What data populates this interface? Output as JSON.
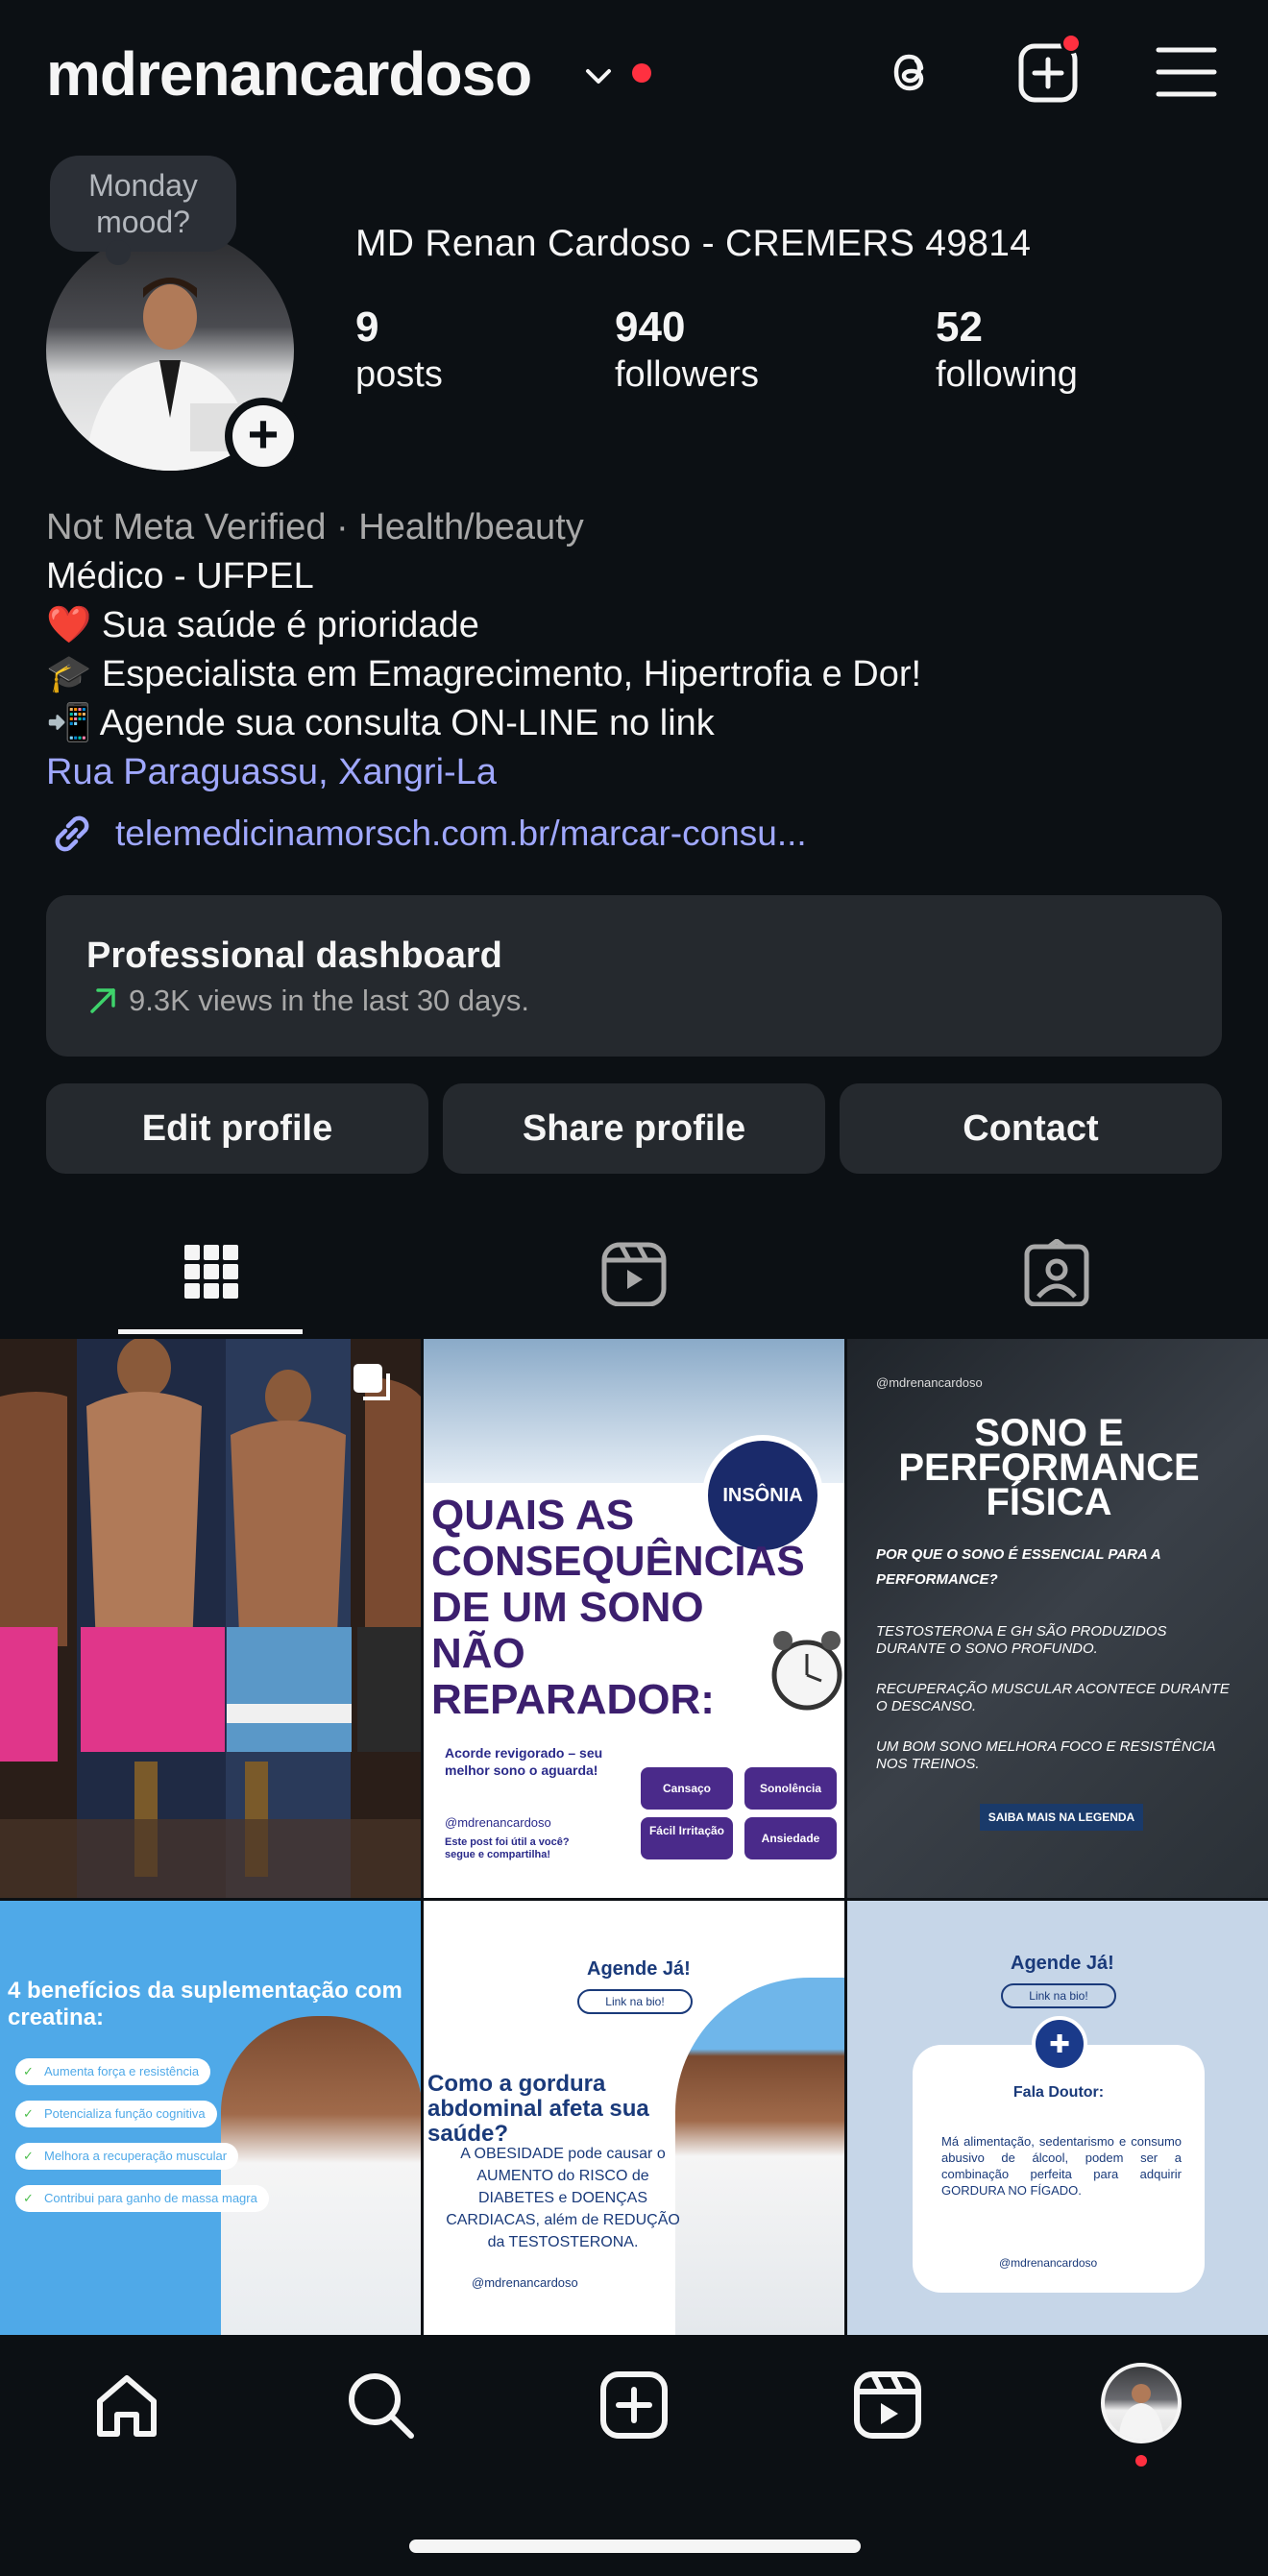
{
  "header": {
    "username": "mdrenancardoso",
    "icons": [
      "chevron-down-icon",
      "threads-icon",
      "create-post-icon",
      "menu-icon"
    ]
  },
  "profile": {
    "note": "Monday mood?",
    "full_name": "MD Renan Cardoso - CREMERS 49814",
    "stats": {
      "posts_count": "9",
      "posts_label": "posts",
      "followers_count": "940",
      "followers_label": "followers",
      "following_count": "52",
      "following_label": "following"
    },
    "bio": {
      "category": "Not Meta Verified · Health/beauty",
      "line1": "Médico - UFPEL",
      "line2": "❤️ Sua saúde é prioridade",
      "line3": "🎓 Especialista em Emagrecimento, Hipertrofia e Dor!",
      "line4": "📲 Agende sua consulta ON-LINE no link",
      "location": "Rua Paraguassu, Xangri-La"
    },
    "website": "telemedicinamorsch.com.br/marcar-consu..."
  },
  "dashboard": {
    "title": "Professional dashboard",
    "subtitle": "9.3K views in the last 30 days."
  },
  "actions": {
    "edit": "Edit profile",
    "share": "Share profile",
    "contact": "Contact"
  },
  "tabs": [
    "grid-tab",
    "reels-tab",
    "tagged-tab"
  ],
  "posts": {
    "p2": {
      "badge": "INSÔNIA",
      "headline": "QUAIS AS CONSEQUÊNCIAS DE UM SONO NÃO REPARADOR:",
      "sub": "Acorde revigorado – seu melhor sono o aguarda!",
      "tags": [
        "Cansaço",
        "Sonolência",
        "Fácil Irritação",
        "Ansiedade"
      ],
      "handle": "@mdrenancardoso",
      "footer": "Este post foi útil a você? segue e compartilha!"
    },
    "p3": {
      "handle": "@mdrenancardoso",
      "title": "SONO E PERFORMANCE FÍSICA",
      "question": "POR QUE O SONO É ESSENCIAL PARA A PERFORMANCE?",
      "items": [
        "TESTOSTERONA E GH SÃO PRODUZIDOS DURANTE O SONO PROFUNDO.",
        "RECUPERAÇÃO MUSCULAR ACONTECE DURANTE O DESCANSO.",
        "UM BOM SONO MELHORA FOCO E RESISTÊNCIA NOS TREINOS."
      ],
      "button": "SAIBA MAIS NA LEGENDA"
    },
    "p4": {
      "title": "4 benefícios da suplementação com creatina:",
      "items": [
        "Aumenta força e resistência",
        "Potencializa função cognitiva",
        "Melhora a recuperação muscular",
        "Contribui para ganho de massa magra"
      ]
    },
    "p5": {
      "agende": "Agende Já!",
      "pill": "Link na bio!",
      "headline": "Como a gordura abdominal afeta sua saúde?",
      "body": "A OBESIDADE pode causar o AUMENTO do RISCO de DIABETES e DOENÇAS CARDIACAS, além de REDUÇÃO da TESTOSTERONA.",
      "handle": "@mdrenancardoso"
    },
    "p6": {
      "agende": "Agende Já!",
      "pill": "Link na bio!",
      "fala": "Fala Doutor:",
      "body": "Má alimentação, sedentarismo e consumo abusivo de álcool, podem ser a combinação perfeita para adquirir GORDURA NO FÍGADO.",
      "handle": "@mdrenancardoso"
    }
  },
  "nav": [
    "home-icon",
    "search-icon",
    "create-icon",
    "reels-icon",
    "profile-avatar"
  ],
  "colors": {
    "background": "#0c1014",
    "surface": "#25292e",
    "link": "#a0a8ff",
    "notification": "#ff3040",
    "trend": "#3ed36b"
  }
}
